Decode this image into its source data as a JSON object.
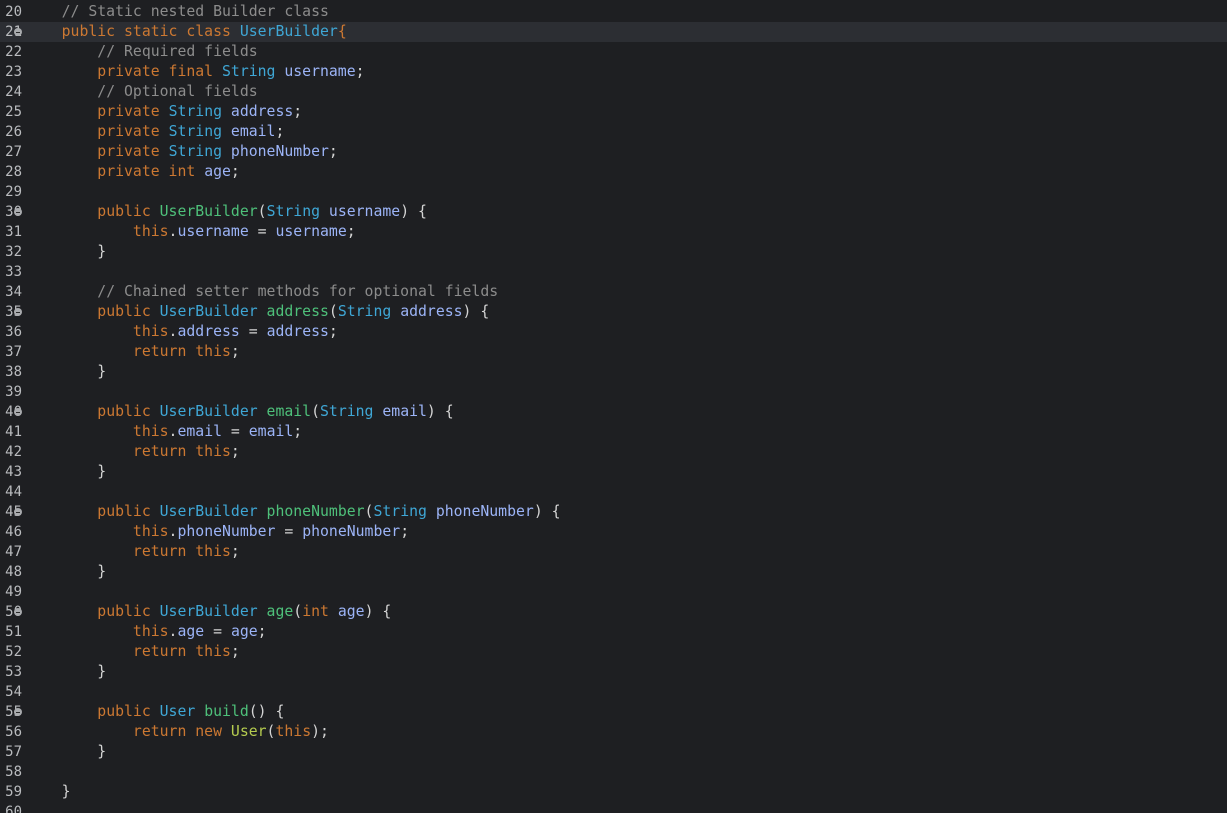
{
  "editor": {
    "active_line": "21",
    "lines": [
      {
        "number": "20",
        "fold": false,
        "tokens": [
          {
            "text": "    ",
            "kind": "plain"
          },
          {
            "text": "// Static nested Builder class",
            "kind": "comment"
          }
        ]
      },
      {
        "number": "21",
        "fold": true,
        "tokens": [
          {
            "text": "    ",
            "kind": "plain"
          },
          {
            "text": "public static class ",
            "kind": "keyword"
          },
          {
            "text": "UserBuilder",
            "kind": "type"
          },
          {
            "text": "{",
            "kind": "keyword"
          }
        ]
      },
      {
        "number": "22",
        "fold": false,
        "tokens": [
          {
            "text": "        ",
            "kind": "plain"
          },
          {
            "text": "// Required fields",
            "kind": "comment"
          }
        ]
      },
      {
        "number": "23",
        "fold": false,
        "tokens": [
          {
            "text": "        ",
            "kind": "plain"
          },
          {
            "text": "private final ",
            "kind": "keyword"
          },
          {
            "text": "String ",
            "kind": "type"
          },
          {
            "text": "username",
            "kind": "field"
          },
          {
            "text": ";",
            "kind": "plain"
          }
        ]
      },
      {
        "number": "24",
        "fold": false,
        "tokens": [
          {
            "text": "        ",
            "kind": "plain"
          },
          {
            "text": "// Optional fields",
            "kind": "comment"
          }
        ]
      },
      {
        "number": "25",
        "fold": false,
        "tokens": [
          {
            "text": "        ",
            "kind": "plain"
          },
          {
            "text": "private ",
            "kind": "keyword"
          },
          {
            "text": "String ",
            "kind": "type"
          },
          {
            "text": "address",
            "kind": "field"
          },
          {
            "text": ";",
            "kind": "plain"
          }
        ]
      },
      {
        "number": "26",
        "fold": false,
        "tokens": [
          {
            "text": "        ",
            "kind": "plain"
          },
          {
            "text": "private ",
            "kind": "keyword"
          },
          {
            "text": "String ",
            "kind": "type"
          },
          {
            "text": "email",
            "kind": "field"
          },
          {
            "text": ";",
            "kind": "plain"
          }
        ]
      },
      {
        "number": "27",
        "fold": false,
        "tokens": [
          {
            "text": "        ",
            "kind": "plain"
          },
          {
            "text": "private ",
            "kind": "keyword"
          },
          {
            "text": "String ",
            "kind": "type"
          },
          {
            "text": "phoneNumber",
            "kind": "field"
          },
          {
            "text": ";",
            "kind": "plain"
          }
        ]
      },
      {
        "number": "28",
        "fold": false,
        "tokens": [
          {
            "text": "        ",
            "kind": "plain"
          },
          {
            "text": "private int ",
            "kind": "keyword"
          },
          {
            "text": "age",
            "kind": "field"
          },
          {
            "text": ";",
            "kind": "plain"
          }
        ]
      },
      {
        "number": "29",
        "fold": false,
        "tokens": []
      },
      {
        "number": "30",
        "fold": true,
        "tokens": [
          {
            "text": "        ",
            "kind": "plain"
          },
          {
            "text": "public ",
            "kind": "keyword"
          },
          {
            "text": "UserBuilder",
            "kind": "method"
          },
          {
            "text": "(",
            "kind": "plain"
          },
          {
            "text": "String ",
            "kind": "type"
          },
          {
            "text": "username",
            "kind": "field"
          },
          {
            "text": ") {",
            "kind": "plain"
          }
        ]
      },
      {
        "number": "31",
        "fold": false,
        "tokens": [
          {
            "text": "            ",
            "kind": "plain"
          },
          {
            "text": "this",
            "kind": "keyword"
          },
          {
            "text": ".",
            "kind": "plain"
          },
          {
            "text": "username",
            "kind": "field"
          },
          {
            "text": " = ",
            "kind": "plain"
          },
          {
            "text": "username",
            "kind": "field"
          },
          {
            "text": ";",
            "kind": "plain"
          }
        ]
      },
      {
        "number": "32",
        "fold": false,
        "tokens": [
          {
            "text": "        }",
            "kind": "plain"
          }
        ]
      },
      {
        "number": "33",
        "fold": false,
        "tokens": []
      },
      {
        "number": "34",
        "fold": false,
        "tokens": [
          {
            "text": "        ",
            "kind": "plain"
          },
          {
            "text": "// Chained setter methods for optional fields",
            "kind": "comment"
          }
        ]
      },
      {
        "number": "35",
        "fold": true,
        "tokens": [
          {
            "text": "        ",
            "kind": "plain"
          },
          {
            "text": "public ",
            "kind": "keyword"
          },
          {
            "text": "UserBuilder ",
            "kind": "type"
          },
          {
            "text": "address",
            "kind": "method"
          },
          {
            "text": "(",
            "kind": "plain"
          },
          {
            "text": "String ",
            "kind": "type"
          },
          {
            "text": "address",
            "kind": "field"
          },
          {
            "text": ") {",
            "kind": "plain"
          }
        ]
      },
      {
        "number": "36",
        "fold": false,
        "tokens": [
          {
            "text": "            ",
            "kind": "plain"
          },
          {
            "text": "this",
            "kind": "keyword"
          },
          {
            "text": ".",
            "kind": "plain"
          },
          {
            "text": "address",
            "kind": "field"
          },
          {
            "text": " = ",
            "kind": "plain"
          },
          {
            "text": "address",
            "kind": "field"
          },
          {
            "text": ";",
            "kind": "plain"
          }
        ]
      },
      {
        "number": "37",
        "fold": false,
        "tokens": [
          {
            "text": "            ",
            "kind": "plain"
          },
          {
            "text": "return this",
            "kind": "keyword"
          },
          {
            "text": ";",
            "kind": "plain"
          }
        ]
      },
      {
        "number": "38",
        "fold": false,
        "tokens": [
          {
            "text": "        }",
            "kind": "plain"
          }
        ]
      },
      {
        "number": "39",
        "fold": false,
        "tokens": []
      },
      {
        "number": "40",
        "fold": true,
        "tokens": [
          {
            "text": "        ",
            "kind": "plain"
          },
          {
            "text": "public ",
            "kind": "keyword"
          },
          {
            "text": "UserBuilder ",
            "kind": "type"
          },
          {
            "text": "email",
            "kind": "method"
          },
          {
            "text": "(",
            "kind": "plain"
          },
          {
            "text": "String ",
            "kind": "type"
          },
          {
            "text": "email",
            "kind": "field"
          },
          {
            "text": ") {",
            "kind": "plain"
          }
        ]
      },
      {
        "number": "41",
        "fold": false,
        "tokens": [
          {
            "text": "            ",
            "kind": "plain"
          },
          {
            "text": "this",
            "kind": "keyword"
          },
          {
            "text": ".",
            "kind": "plain"
          },
          {
            "text": "email",
            "kind": "field"
          },
          {
            "text": " = ",
            "kind": "plain"
          },
          {
            "text": "email",
            "kind": "field"
          },
          {
            "text": ";",
            "kind": "plain"
          }
        ]
      },
      {
        "number": "42",
        "fold": false,
        "tokens": [
          {
            "text": "            ",
            "kind": "plain"
          },
          {
            "text": "return this",
            "kind": "keyword"
          },
          {
            "text": ";",
            "kind": "plain"
          }
        ]
      },
      {
        "number": "43",
        "fold": false,
        "tokens": [
          {
            "text": "        }",
            "kind": "plain"
          }
        ]
      },
      {
        "number": "44",
        "fold": false,
        "tokens": []
      },
      {
        "number": "45",
        "fold": true,
        "tokens": [
          {
            "text": "        ",
            "kind": "plain"
          },
          {
            "text": "public ",
            "kind": "keyword"
          },
          {
            "text": "UserBuilder ",
            "kind": "type"
          },
          {
            "text": "phoneNumber",
            "kind": "method"
          },
          {
            "text": "(",
            "kind": "plain"
          },
          {
            "text": "String ",
            "kind": "type"
          },
          {
            "text": "phoneNumber",
            "kind": "field"
          },
          {
            "text": ") {",
            "kind": "plain"
          }
        ]
      },
      {
        "number": "46",
        "fold": false,
        "tokens": [
          {
            "text": "            ",
            "kind": "plain"
          },
          {
            "text": "this",
            "kind": "keyword"
          },
          {
            "text": ".",
            "kind": "plain"
          },
          {
            "text": "phoneNumber",
            "kind": "field"
          },
          {
            "text": " = ",
            "kind": "plain"
          },
          {
            "text": "phoneNumber",
            "kind": "field"
          },
          {
            "text": ";",
            "kind": "plain"
          }
        ]
      },
      {
        "number": "47",
        "fold": false,
        "tokens": [
          {
            "text": "            ",
            "kind": "plain"
          },
          {
            "text": "return this",
            "kind": "keyword"
          },
          {
            "text": ";",
            "kind": "plain"
          }
        ]
      },
      {
        "number": "48",
        "fold": false,
        "tokens": [
          {
            "text": "        }",
            "kind": "plain"
          }
        ]
      },
      {
        "number": "49",
        "fold": false,
        "tokens": []
      },
      {
        "number": "50",
        "fold": true,
        "tokens": [
          {
            "text": "        ",
            "kind": "plain"
          },
          {
            "text": "public ",
            "kind": "keyword"
          },
          {
            "text": "UserBuilder ",
            "kind": "type"
          },
          {
            "text": "age",
            "kind": "method"
          },
          {
            "text": "(",
            "kind": "plain"
          },
          {
            "text": "int ",
            "kind": "keyword"
          },
          {
            "text": "age",
            "kind": "field"
          },
          {
            "text": ") {",
            "kind": "plain"
          }
        ]
      },
      {
        "number": "51",
        "fold": false,
        "tokens": [
          {
            "text": "            ",
            "kind": "plain"
          },
          {
            "text": "this",
            "kind": "keyword"
          },
          {
            "text": ".",
            "kind": "plain"
          },
          {
            "text": "age",
            "kind": "field"
          },
          {
            "text": " = ",
            "kind": "plain"
          },
          {
            "text": "age",
            "kind": "field"
          },
          {
            "text": ";",
            "kind": "plain"
          }
        ]
      },
      {
        "number": "52",
        "fold": false,
        "tokens": [
          {
            "text": "            ",
            "kind": "plain"
          },
          {
            "text": "return this",
            "kind": "keyword"
          },
          {
            "text": ";",
            "kind": "plain"
          }
        ]
      },
      {
        "number": "53",
        "fold": false,
        "tokens": [
          {
            "text": "        }",
            "kind": "plain"
          }
        ]
      },
      {
        "number": "54",
        "fold": false,
        "tokens": []
      },
      {
        "number": "55",
        "fold": true,
        "tokens": [
          {
            "text": "        ",
            "kind": "plain"
          },
          {
            "text": "public ",
            "kind": "keyword"
          },
          {
            "text": "User ",
            "kind": "type"
          },
          {
            "text": "build",
            "kind": "method"
          },
          {
            "text": "() {",
            "kind": "plain"
          }
        ]
      },
      {
        "number": "56",
        "fold": false,
        "tokens": [
          {
            "text": "            ",
            "kind": "plain"
          },
          {
            "text": "return new ",
            "kind": "keyword"
          },
          {
            "text": "User",
            "kind": "ctor"
          },
          {
            "text": "(",
            "kind": "plain"
          },
          {
            "text": "this",
            "kind": "keyword"
          },
          {
            "text": ");",
            "kind": "plain"
          }
        ]
      },
      {
        "number": "57",
        "fold": false,
        "tokens": [
          {
            "text": "        }",
            "kind": "plain"
          }
        ]
      },
      {
        "number": "58",
        "fold": false,
        "tokens": []
      },
      {
        "number": "59",
        "fold": false,
        "tokens": [
          {
            "text": "    }",
            "kind": "plain"
          }
        ]
      },
      {
        "number": "60",
        "fold": false,
        "tokens": []
      }
    ]
  },
  "colors": {
    "background": "#1e1f22",
    "active_line": "#2c2e33",
    "comment": "#8c8c8c",
    "keyword": "#cc7832",
    "type": "#3fa7d6",
    "field": "#9cb4f7",
    "method": "#4ec07a",
    "constructor_call": "#b5cc4f",
    "plain": "#d4d4d4"
  }
}
